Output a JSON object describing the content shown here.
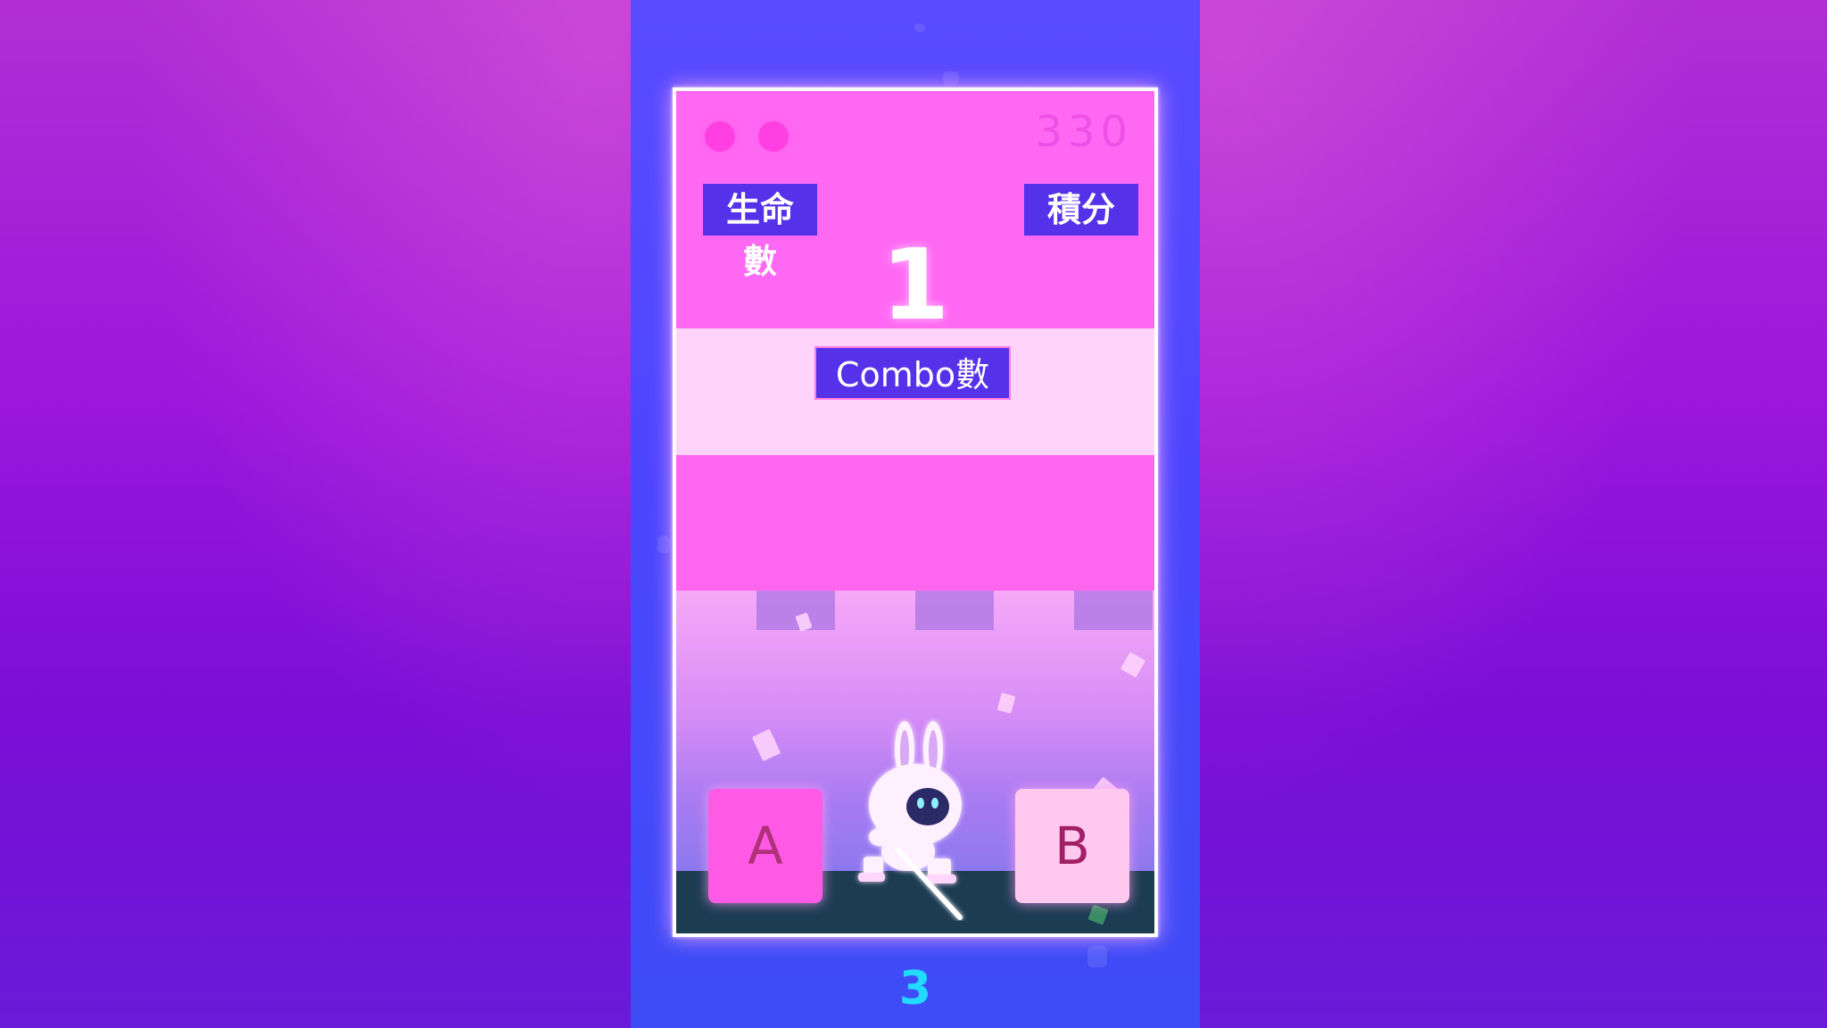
{
  "hud": {
    "lives_label": "生命數",
    "score_label": "積分",
    "score_value": "330",
    "combo_count": "1",
    "combo_label": "Combo數",
    "lives_remaining": 2
  },
  "controls": {
    "button_a": "A",
    "button_b": "B"
  },
  "round_indicator": "3",
  "colors": {
    "hud_label_bg": "#5532ea",
    "top_band": "#ff68f3",
    "combo_band": "#ffd3fb",
    "round_number": "#22d9ff",
    "ground": "#1c3c52"
  }
}
